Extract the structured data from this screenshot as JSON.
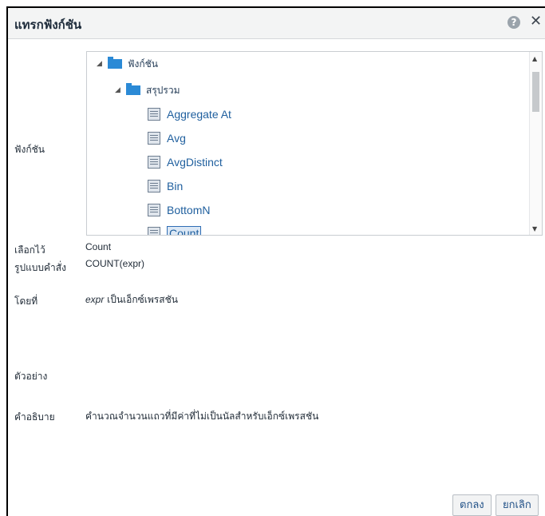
{
  "dialog": {
    "title": "แทรกฟังก์ชัน",
    "help_glyph": "?",
    "close_glyph": "✕"
  },
  "form": {
    "function_label": "ฟังก์ชัน",
    "selected_label": "เลือกไว้",
    "selected_value": "Count",
    "syntax_label": "รูปแบบคำสั่ง",
    "syntax_value": "COUNT(expr)",
    "where_label": "โดยที่",
    "where_param": "expr",
    "where_text": " เป็นเอ็กซ์เพรสชัน",
    "example_label": "ตัวอย่าง",
    "description_label": "คำอธิบาย",
    "description_value": "คำนวณจำนวนแถวที่มีค่าที่ไม่เป็นนัลสำหรับเอ็กซ์เพรสชัน"
  },
  "tree": {
    "root_label": "ฟังก์ชัน",
    "group_label": "สรุปรวม",
    "items": [
      "Aggregate At",
      "Avg",
      "AvgDistinct",
      "Bin",
      "BottomN",
      "Count"
    ],
    "selected_item": "Count"
  },
  "buttons": {
    "ok_label": "ตกลง",
    "cancel_label": "ยกเลิก"
  }
}
